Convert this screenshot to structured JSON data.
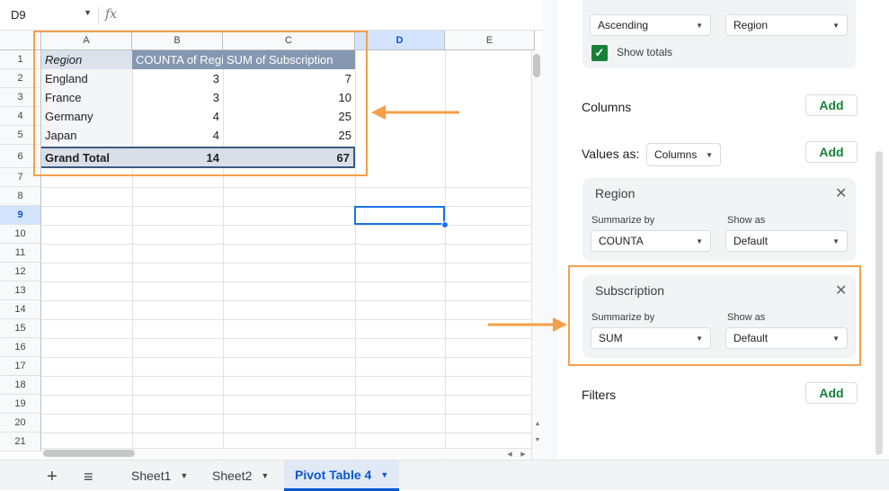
{
  "formula_bar": {
    "name_box": "D9",
    "fx": "fx"
  },
  "columns": [
    "A",
    "B",
    "C",
    "D",
    "E"
  ],
  "rows": [
    "1",
    "2",
    "3",
    "4",
    "5",
    "6",
    "7",
    "8",
    "9",
    "10",
    "11",
    "12",
    "13",
    "14",
    "15",
    "16",
    "17",
    "18",
    "19",
    "20",
    "21"
  ],
  "pivot": {
    "header": {
      "region": "Region",
      "count": "COUNTA of Region",
      "sum": "SUM of Subscription"
    },
    "rows": [
      {
        "region": "England",
        "count": "3",
        "sum": "7"
      },
      {
        "region": "France",
        "count": "3",
        "sum": "10"
      },
      {
        "region": "Germany",
        "count": "4",
        "sum": "25"
      },
      {
        "region": "Japan",
        "count": "4",
        "sum": "25"
      }
    ],
    "total": {
      "label": "Grand Total",
      "count": "14",
      "sum": "67"
    }
  },
  "tabs": {
    "add": "+",
    "menu": "≡",
    "sheets": [
      {
        "label": "Sheet1"
      },
      {
        "label": "Sheet2"
      },
      {
        "label": "Pivot Table 4"
      }
    ],
    "active": "Pivot Table 4"
  },
  "panel": {
    "rows_card": {
      "order": "Ascending",
      "sort_by": "Region",
      "show_totals": "Show totals"
    },
    "columns": {
      "title": "Columns",
      "add": "Add"
    },
    "values": {
      "title": "Values as:",
      "mode": "Columns",
      "add": "Add",
      "items": [
        {
          "title": "Region",
          "summarize_label": "Summarize by",
          "summarize": "COUNTA",
          "show_as_label": "Show as",
          "show_as": "Default"
        },
        {
          "title": "Subscription",
          "summarize_label": "Summarize by",
          "summarize": "SUM",
          "show_as_label": "Show as",
          "show_as": "Default"
        }
      ]
    },
    "filters": {
      "title": "Filters",
      "add": "Add"
    }
  },
  "colors": {
    "accent_orange": "#f59f4b",
    "selection_blue": "#1a73e8",
    "add_green": "#188038",
    "pivot_header": "#8597b1"
  }
}
